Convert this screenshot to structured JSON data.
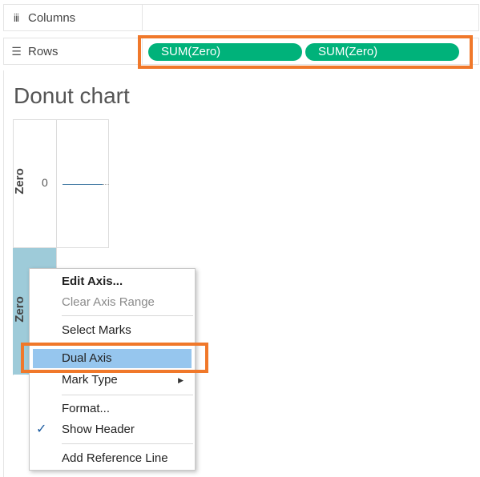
{
  "shelves": {
    "columns": {
      "icon": "iii",
      "label": "Columns"
    },
    "rows": {
      "icon": "☰",
      "label": "Rows",
      "pills": [
        "SUM(Zero)",
        "SUM(Zero)"
      ]
    }
  },
  "view": {
    "title": "Donut chart",
    "top_axis_label": "Zero",
    "bottom_axis_label": "Zero",
    "tick_value": "0"
  },
  "context_menu": {
    "items": [
      {
        "label": "Edit Axis...",
        "style": "bold"
      },
      {
        "label": "Clear Axis Range",
        "style": "disabled"
      },
      {
        "label": "Select Marks"
      },
      {
        "label": "Dual Axis",
        "style": "active"
      },
      {
        "label": "Mark Type",
        "submenu": true
      },
      {
        "label": "Format..."
      },
      {
        "label": "Show Header",
        "checked": true
      },
      {
        "label": "Add Reference Line"
      }
    ]
  },
  "colors": {
    "pill": "#00b27a",
    "highlight": "#f0782a",
    "menu_active": "#96c6ee",
    "header_cell": "#9ecbd9"
  }
}
